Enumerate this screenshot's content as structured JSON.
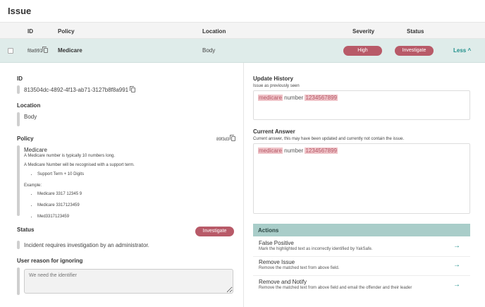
{
  "page_title": "Issue",
  "table": {
    "headers": {
      "id": "ID",
      "policy": "Policy",
      "location": "Location",
      "severity": "Severity",
      "status": "Status"
    },
    "row": {
      "id": "f8a991",
      "policy": "Medicare",
      "location": "Body",
      "severity": "High",
      "status": "Investigate",
      "toggle_label": "Less"
    }
  },
  "details": {
    "id_label": "ID",
    "id_value": "813504dc-4892-4f13-ab71-3127b8f8a991",
    "location_label": "Location",
    "location_value": "Body",
    "policy_label": "Policy",
    "policy_code": "89f3d3",
    "policy_name": "Medicare",
    "policy_desc_1": "A Medicare number is typically 10 numbers long.",
    "policy_desc_2": "A Medicare Number will be recognised with a support term.",
    "policy_terms": [
      "Support Term + 10 Digits"
    ],
    "example_label": "Example:",
    "policy_examples": [
      "Medicare 3317 12345 9",
      "Medicare 3317123459",
      "Med3317123459"
    ],
    "status_label": "Status",
    "status_badge": "Investigate",
    "status_value": "Incident requires investigation by an administrator.",
    "ignore_label": "User reason for ignoring",
    "ignore_placeholder": "We need the identifier"
  },
  "history": {
    "label": "Update History",
    "sublabel": "Issue as previously seen",
    "text_hl_1": "medicare",
    "text_mid": " number ",
    "text_hl_2": "1234567899"
  },
  "current": {
    "label": "Current Answer",
    "sublabel": "Current answer, this may have been updated and currently not contain the issue.",
    "text_hl_1": "medicare",
    "text_mid": " number ",
    "text_hl_2": "1234567899"
  },
  "actions": {
    "header": "Actions",
    "items": [
      {
        "title": "False Positive",
        "desc": "Mark the highlighted text as incorrectly identified by YakSafe."
      },
      {
        "title": "Remove Issue",
        "desc": "Remove the matched text from above field."
      },
      {
        "title": "Remove and Notify",
        "desc": "Remove the matched text from above field and email the offender and their leader"
      }
    ]
  },
  "colors": {
    "accent": "#1f8f8a",
    "pill": "#b85a68",
    "row_bg": "#dfecea",
    "actions_header": "#a9cdc9",
    "highlight": "#f0c4c9"
  },
  "icons": {
    "copy": "copy-icon",
    "chevron": "chevron-up-icon",
    "arrow": "arrow-right-icon"
  }
}
